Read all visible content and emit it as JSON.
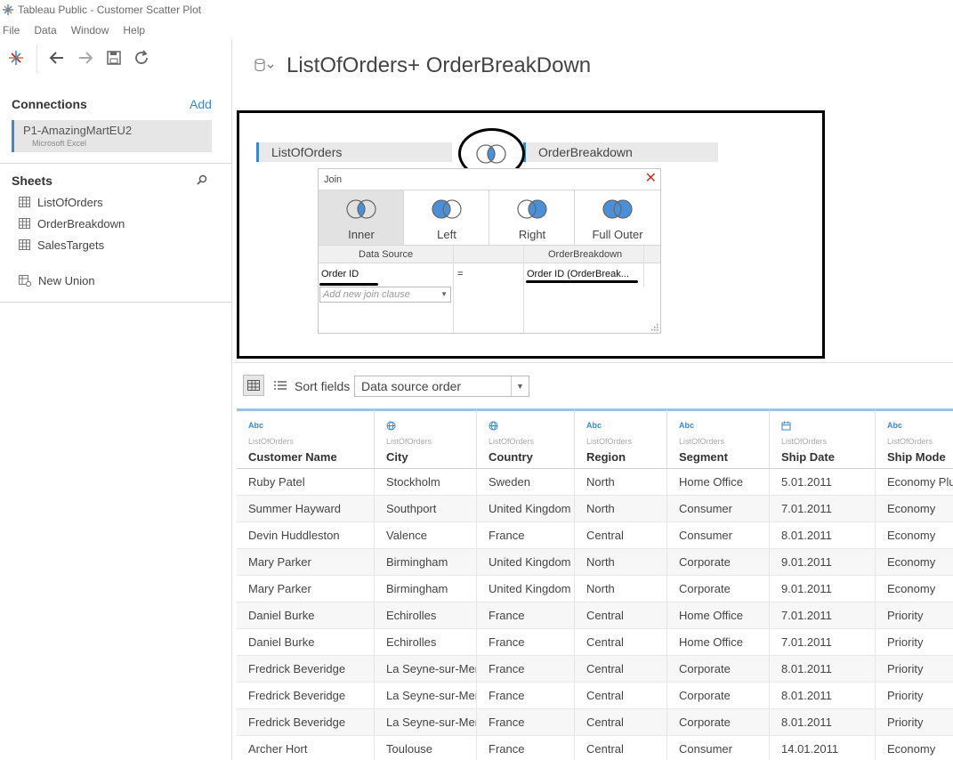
{
  "window": {
    "title": "Tableau Public - Customer Scatter Plot"
  },
  "menu": [
    "File",
    "Data",
    "Window",
    "Help"
  ],
  "connections": {
    "heading": "Connections",
    "add_label": "Add",
    "item": {
      "name": "P1-AmazingMartEU2",
      "type": "Microsoft Excel"
    }
  },
  "sheets": {
    "heading": "Sheets",
    "items": [
      "ListOfOrders",
      "OrderBreakdown",
      "SalesTargets"
    ],
    "new_union": "New Union"
  },
  "datasource": {
    "title": "ListOfOrders+ OrderBreakDown"
  },
  "canvas": {
    "left_table": "ListOfOrders",
    "right_table": "OrderBreakdown"
  },
  "join_dialog": {
    "title": "Join",
    "close": "✕",
    "types": [
      "Inner",
      "Left",
      "Right",
      "Full Outer"
    ],
    "selected": "Inner",
    "col_left": "Data Source",
    "col_right": "OrderBreakdown",
    "clause": {
      "left": "Order ID",
      "op": "=",
      "right": "Order ID (OrderBreak..."
    },
    "add_clause_placeholder": "Add new join clause"
  },
  "sort": {
    "label": "Sort fields",
    "value": "Data source order"
  },
  "grid": {
    "columns": [
      {
        "type": "Abc",
        "icon": "string-type-icon",
        "source": "ListOfOrders",
        "name": "Customer Name"
      },
      {
        "type": "globe",
        "icon": "geo-type-icon",
        "source": "ListOfOrders",
        "name": "City"
      },
      {
        "type": "globe",
        "icon": "geo-type-icon",
        "source": "ListOfOrders",
        "name": "Country"
      },
      {
        "type": "Abc",
        "icon": "string-type-icon",
        "source": "ListOfOrders",
        "name": "Region"
      },
      {
        "type": "Abc",
        "icon": "string-type-icon",
        "source": "ListOfOrders",
        "name": "Segment"
      },
      {
        "type": "calendar",
        "icon": "date-type-icon",
        "source": "ListOfOrders",
        "name": "Ship Date"
      },
      {
        "type": "Abc",
        "icon": "string-type-icon",
        "source": "ListOfOrders",
        "name": "Ship Mode"
      }
    ],
    "rows": [
      [
        "Ruby Patel",
        "Stockholm",
        "Sweden",
        "North",
        "Home Office",
        "5.01.2011",
        "Economy Plus"
      ],
      [
        "Summer Hayward",
        "Southport",
        "United Kingdom",
        "North",
        "Consumer",
        "7.01.2011",
        "Economy"
      ],
      [
        "Devin Huddleston",
        "Valence",
        "France",
        "Central",
        "Consumer",
        "8.01.2011",
        "Economy"
      ],
      [
        "Mary Parker",
        "Birmingham",
        "United Kingdom",
        "North",
        "Corporate",
        "9.01.2011",
        "Economy"
      ],
      [
        "Mary Parker",
        "Birmingham",
        "United Kingdom",
        "North",
        "Corporate",
        "9.01.2011",
        "Economy"
      ],
      [
        "Daniel Burke",
        "Echirolles",
        "France",
        "Central",
        "Home Office",
        "7.01.2011",
        "Priority"
      ],
      [
        "Daniel Burke",
        "Echirolles",
        "France",
        "Central",
        "Home Office",
        "7.01.2011",
        "Priority"
      ],
      [
        "Fredrick Beveridge",
        "La Seyne-sur-Mer",
        "France",
        "Central",
        "Corporate",
        "8.01.2011",
        "Priority"
      ],
      [
        "Fredrick Beveridge",
        "La Seyne-sur-Mer",
        "France",
        "Central",
        "Corporate",
        "8.01.2011",
        "Priority"
      ],
      [
        "Fredrick Beveridge",
        "La Seyne-sur-Mer",
        "France",
        "Central",
        "Corporate",
        "8.01.2011",
        "Priority"
      ],
      [
        "Archer Hort",
        "Toulouse",
        "France",
        "Central",
        "Consumer",
        "14.01.2011",
        "Economy"
      ]
    ]
  },
  "colors": {
    "accent": "#3e88c8",
    "venn_fill": "#4a90d9"
  }
}
